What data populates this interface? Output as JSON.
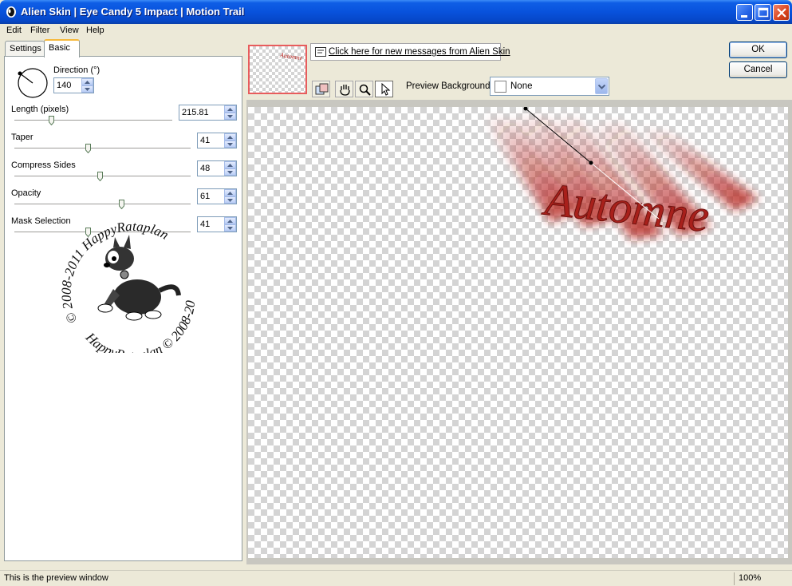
{
  "window": {
    "title": "Alien Skin  |  Eye Candy 5 Impact  |  Motion Trail"
  },
  "menu": [
    "Edit",
    "Filter",
    "View",
    "Help"
  ],
  "tabs": [
    "Settings",
    "Basic"
  ],
  "basic": {
    "direction_label": "Direction (°)",
    "direction_value": "140",
    "length_label": "Length (pixels)",
    "length_value": "215.81",
    "taper_label": "Taper",
    "taper_value": "41",
    "compress_label": "Compress Sides",
    "compress_value": "48",
    "opacity_label": "Opacity",
    "opacity_value": "61",
    "mask_label": "Mask Selection",
    "mask_value": "41"
  },
  "logo": {
    "top_arc": "© 2008-2011  HappyRataplan",
    "bottom_arc": "HappyRataplan  © 2008-2011"
  },
  "messages": {
    "link": "Click here for new messages from Alien Skin"
  },
  "preview_bg": {
    "label": "Preview Background:",
    "value": "None"
  },
  "buttons": {
    "ok": "OK",
    "cancel": "Cancel"
  },
  "preview": {
    "text": "Automne",
    "thumb_text": "Automne"
  },
  "status": {
    "text": "This is the preview window",
    "zoom": "100%"
  },
  "colors": {
    "trail": "#b5211c",
    "titlebar": "#0852dc"
  }
}
